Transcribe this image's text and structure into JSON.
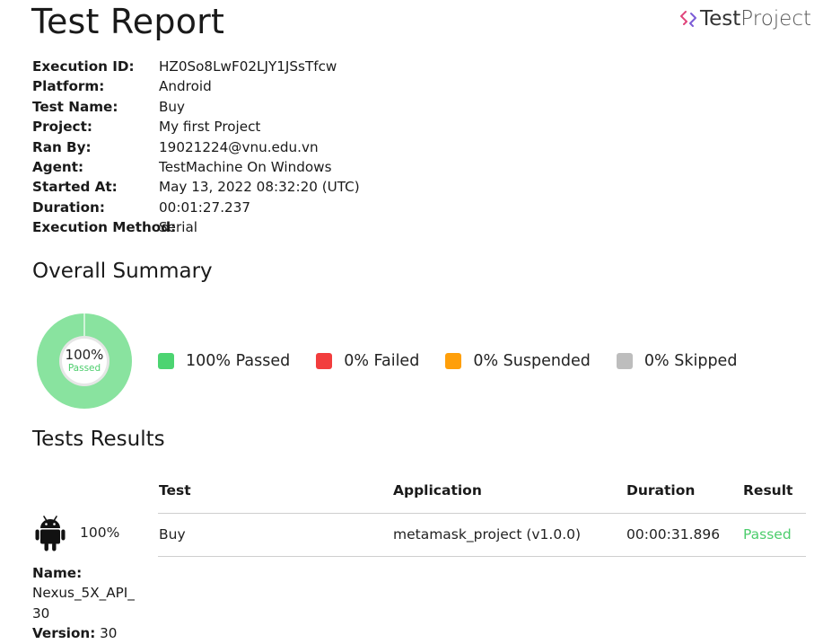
{
  "header": {
    "title": "Test Report",
    "brand_bold": "Test",
    "brand_light": "Project"
  },
  "details": [
    {
      "label": "Execution ID:",
      "value": "HZ0So8LwF02LJY1JSsTfcw"
    },
    {
      "label": "Platform:",
      "value": "Android"
    },
    {
      "label": "Test Name:",
      "value": "Buy"
    },
    {
      "label": "Project:",
      "value": "My first Project"
    },
    {
      "label": "Ran By:",
      "value": "19021224@vnu.edu.vn"
    },
    {
      "label": "Agent:",
      "value": "TestMachine On Windows"
    },
    {
      "label": "Started At:",
      "value": "May 13, 2022 08:32:20 (UTC)"
    },
    {
      "label": "Duration:",
      "value": "00:01:27.237"
    },
    {
      "label": "Execution Method:",
      "value": "Serial"
    }
  ],
  "summary": {
    "heading": "Overall Summary",
    "donut_value": "100%",
    "donut_label": "Passed",
    "passed_fraction": 1.0,
    "legend": [
      {
        "label": "100% Passed",
        "color": "#4cd471"
      },
      {
        "label": "0% Failed",
        "color": "#f23d3d"
      },
      {
        "label": "0% Suspended",
        "color": "#ff9f0a"
      },
      {
        "label": "0% Skipped",
        "color": "#bdbdbd"
      }
    ]
  },
  "results": {
    "heading": "Tests Results",
    "columns": [
      "Test",
      "Application",
      "Duration",
      "Result"
    ],
    "rows": [
      {
        "test": "Buy",
        "application": "metamask_project (v1.0.0)",
        "duration": "00:00:31.896",
        "result": "Passed"
      }
    ],
    "result_color": "#4ccd6c",
    "device": {
      "percent": "100%",
      "name_label": "Name:",
      "name_line1": "Nexus_5X_API_",
      "name_line2": "30",
      "version_label": "Version:",
      "version_value": " 30"
    }
  }
}
